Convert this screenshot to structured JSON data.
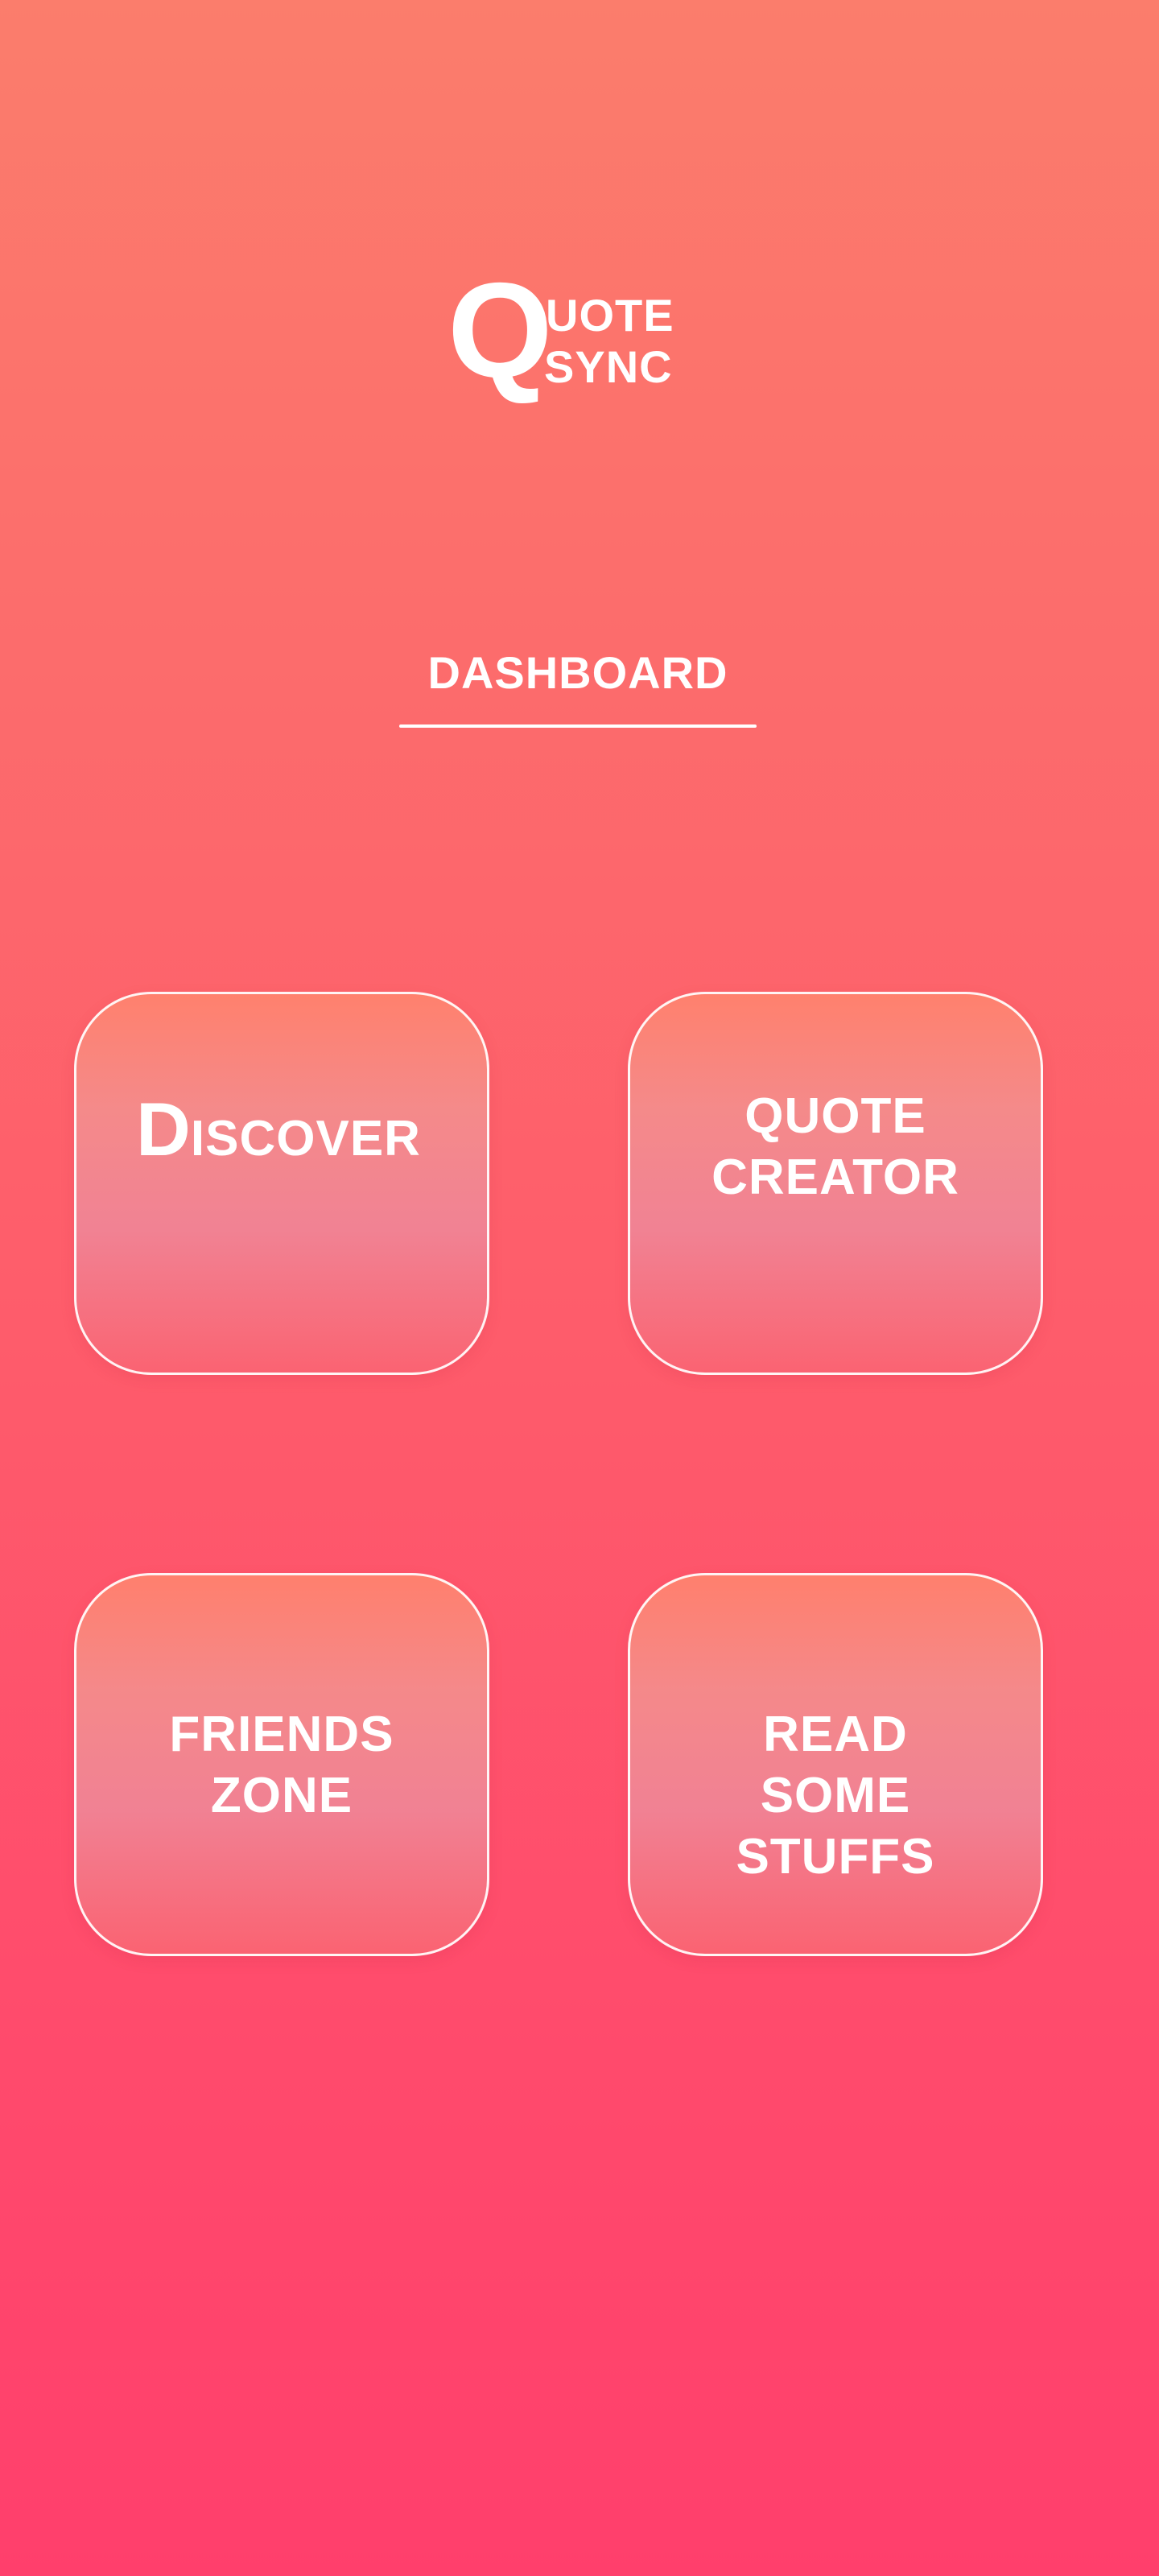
{
  "app": {
    "logo": {
      "big_letter": "Q",
      "line1": "UOTE",
      "line2": "SYNC"
    }
  },
  "header": {
    "title": "DASHBOARD"
  },
  "tiles": {
    "discover": {
      "first_letter": "D",
      "rest": "ISCOVER"
    },
    "quote_creator": {
      "label": "QUOTE\nCREATOR"
    },
    "friends_zone": {
      "label": "FRIENDS\nZONE"
    },
    "read_stuffs": {
      "label": "READ\nSOME\nSTUFFS"
    }
  },
  "colors": {
    "background_top": "#fb7d6c",
    "background_bottom": "#ff3f6c",
    "text": "#ffffff",
    "tile_border": "#ffffff"
  }
}
